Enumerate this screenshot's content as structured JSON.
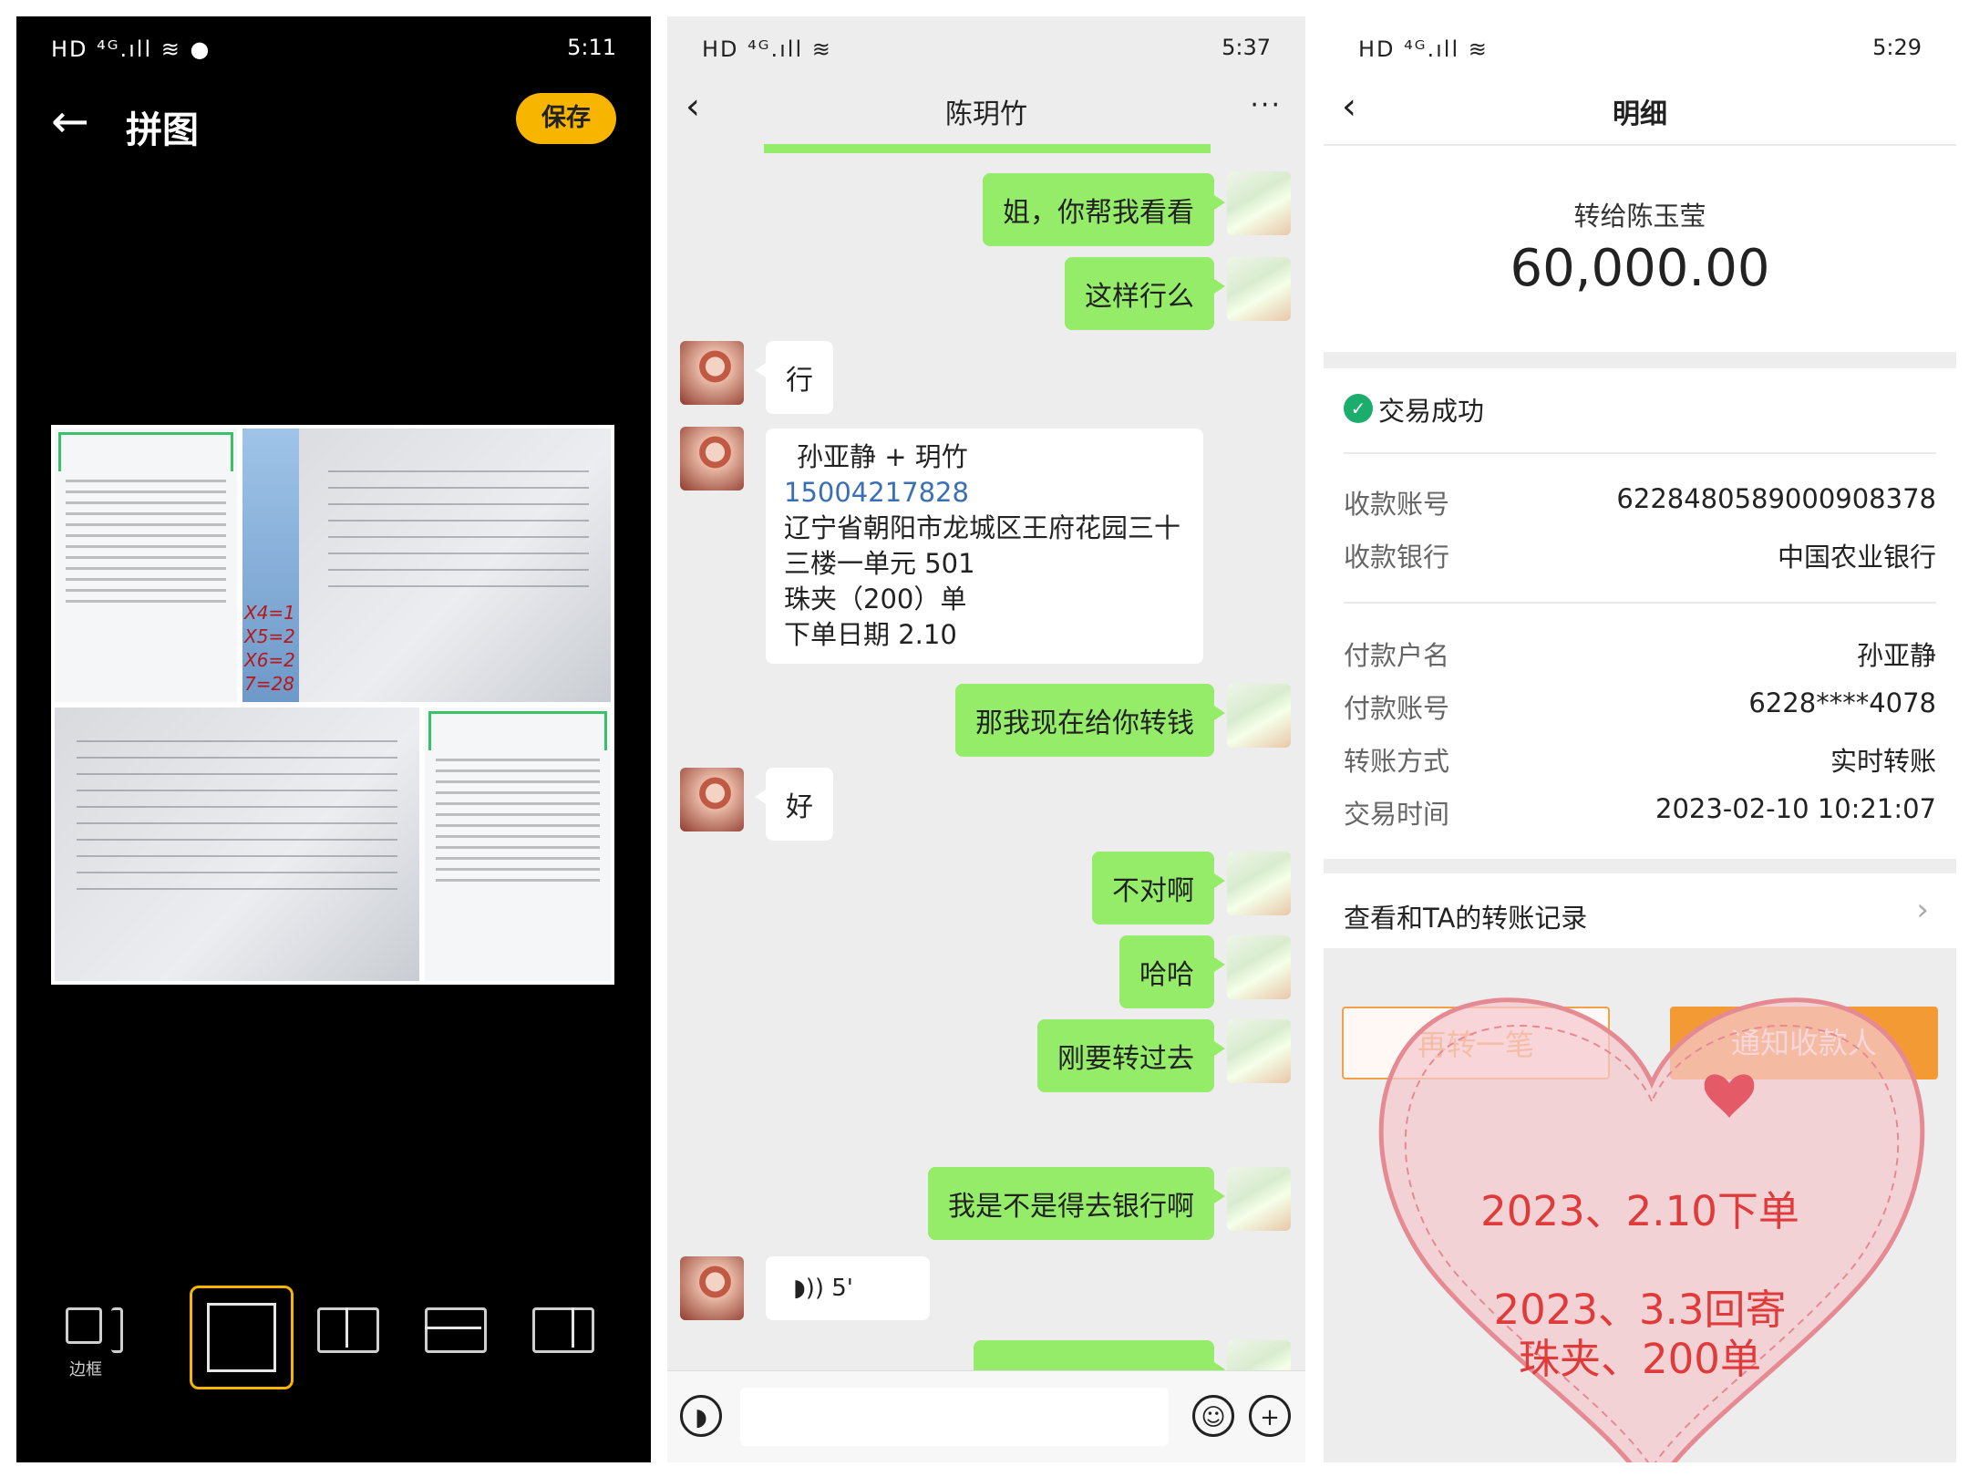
{
  "colors": {
    "accent_yellow": "#f7b500",
    "wechat_green": "#95ec69",
    "note_red": "#e03b3b",
    "notify_orange": "#f49a34"
  },
  "panel1": {
    "status": {
      "left": "HD ⁴ᴳ.ıll ≋ ●",
      "time": "5:11"
    },
    "title": "拼图",
    "save_label": "保存",
    "border_label": "边框",
    "markers": [
      "X4=1",
      "X5=2",
      "X6=2",
      "7=28"
    ]
  },
  "panel2": {
    "status": {
      "left": "HD ⁴ᴳ.ıll ≋",
      "time": "5:37"
    },
    "contact_name": "陈玥竹",
    "messages": [
      {
        "from": "me",
        "text": "姐，你帮我看看"
      },
      {
        "from": "me",
        "text": "这样行么"
      },
      {
        "from": "them",
        "text": "行"
      },
      {
        "from": "them",
        "card": {
          "line1": "孙亚静   + 玥竹",
          "phone": "15004217828",
          "address": "辽宁省朝阳市龙城区王府花园三十三楼一单元 501",
          "item": "珠夹（200）单",
          "date": "下单日期 2.10"
        }
      },
      {
        "from": "me",
        "text": "那我现在给你转钱"
      },
      {
        "from": "them",
        "text": "好"
      },
      {
        "from": "me",
        "text": "不对啊"
      },
      {
        "from": "me",
        "text": "哈哈"
      },
      {
        "from": "me",
        "text": "刚要转过去"
      },
      {
        "from": "me",
        "text": "我是不是得去银行啊"
      },
      {
        "from": "them",
        "voice": "5'"
      }
    ]
  },
  "panel3": {
    "status": {
      "left": "HD ⁴ᴳ.ıll ≋",
      "time": "5:29"
    },
    "title": "明细",
    "to": "转给陈玉莹",
    "amount": "60,000.00",
    "status_text": "交易成功",
    "fields": [
      {
        "k": "收款账号",
        "v": "6228480589000908378"
      },
      {
        "k": "收款银行",
        "v": "中国农业银行"
      },
      {
        "k": "付款户名",
        "v": "孙亚静"
      },
      {
        "k": "付款账号",
        "v": "6228****4078"
      },
      {
        "k": "转账方式",
        "v": "实时转账"
      },
      {
        "k": "交易时间",
        "v": "2023-02-10 10:21:07"
      }
    ],
    "records_link": "查看和TA的转账记录",
    "btn_again": "再转一笔",
    "btn_notify": "通知收款人",
    "note_lines": [
      "2023、2.10下单",
      "2023、3.3回寄",
      "珠夹、200单"
    ]
  }
}
